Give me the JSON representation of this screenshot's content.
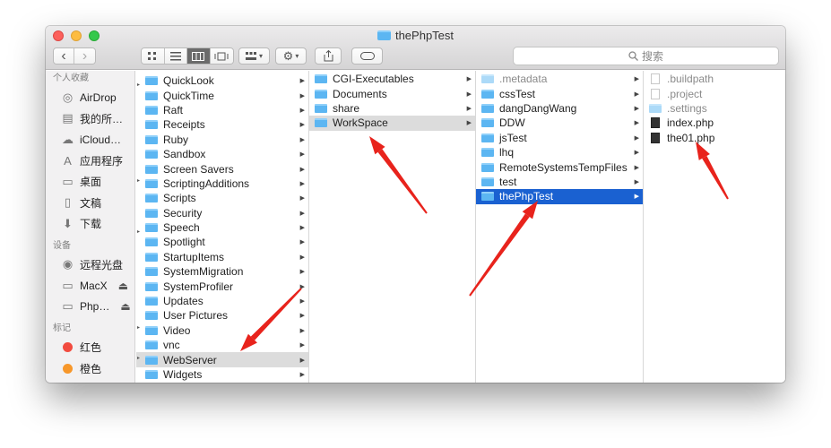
{
  "window": {
    "title": "thePhpTest"
  },
  "toolbar": {
    "nav_back": "‹",
    "nav_forward": "›",
    "search_placeholder": "搜索"
  },
  "sidebar": {
    "sections": [
      {
        "label": "个人收藏",
        "items": [
          {
            "label": "AirDrop",
            "icon": "airdrop-icon"
          },
          {
            "label": "我的所…",
            "icon": "documents-icon"
          },
          {
            "label": "iCloud…",
            "icon": "cloud-icon"
          },
          {
            "label": "应用程序",
            "icon": "applications-icon"
          },
          {
            "label": "桌面",
            "icon": "desktop-icon"
          },
          {
            "label": "文稿",
            "icon": "document-icon"
          },
          {
            "label": "下载",
            "icon": "download-icon"
          }
        ]
      },
      {
        "label": "设备",
        "items": [
          {
            "label": "远程光盘",
            "icon": "disc-icon"
          },
          {
            "label": "MacX",
            "icon": "drive-icon",
            "eject": "⏏"
          },
          {
            "label": "Php…",
            "icon": "drive-icon",
            "eject": "⏏"
          }
        ]
      },
      {
        "label": "标记",
        "items": [
          {
            "label": "红色",
            "color": "#f24b3f"
          },
          {
            "label": "橙色",
            "color": "#f7972a"
          }
        ]
      }
    ]
  },
  "columns": [
    {
      "items": [
        {
          "label": "QuickLook",
          "arrow": true
        },
        {
          "label": "QuickTime",
          "arrow": true
        },
        {
          "label": "Raft",
          "arrow": true
        },
        {
          "label": "Receipts",
          "arrow": true
        },
        {
          "label": "Ruby",
          "arrow": true
        },
        {
          "label": "Sandbox",
          "arrow": true
        },
        {
          "label": "Screen Savers",
          "arrow": true
        },
        {
          "label": "ScriptingAdditions",
          "arrow": true
        },
        {
          "label": "Scripts",
          "arrow": true
        },
        {
          "label": "Security",
          "arrow": true
        },
        {
          "label": "Speech",
          "arrow": true
        },
        {
          "label": "Spotlight",
          "arrow": true
        },
        {
          "label": "StartupItems",
          "arrow": true
        },
        {
          "label": "SystemMigration",
          "arrow": true
        },
        {
          "label": "SystemProfiler",
          "arrow": true
        },
        {
          "label": "Updates",
          "arrow": true
        },
        {
          "label": "User Pictures",
          "arrow": true
        },
        {
          "label": "Video",
          "arrow": true
        },
        {
          "label": "vnc",
          "arrow": true
        },
        {
          "label": "WebServer",
          "arrow": true,
          "selected": "gray"
        },
        {
          "label": "Widgets",
          "arrow": true
        }
      ]
    },
    {
      "items": [
        {
          "label": "CGI-Executables",
          "arrow": true
        },
        {
          "label": "Documents",
          "arrow": true
        },
        {
          "label": "share",
          "arrow": true
        },
        {
          "label": "WorkSpace",
          "arrow": true,
          "selected": "gray"
        }
      ]
    },
    {
      "items": [
        {
          "label": ".metadata",
          "arrow": true,
          "faded": true
        },
        {
          "label": "cssTest",
          "arrow": true
        },
        {
          "label": "dangDangWang",
          "arrow": true
        },
        {
          "label": "DDW",
          "arrow": true
        },
        {
          "label": "jsTest",
          "arrow": true
        },
        {
          "label": "lhq",
          "arrow": true
        },
        {
          "label": "RemoteSystemsTempFiles",
          "arrow": true
        },
        {
          "label": "test",
          "arrow": true
        },
        {
          "label": "thePhpTest",
          "arrow": true,
          "selected": "blue"
        }
      ]
    },
    {
      "items": [
        {
          "label": ".buildpath",
          "kind": "file",
          "faded": true
        },
        {
          "label": ".project",
          "kind": "file",
          "faded": true
        },
        {
          "label": ".settings",
          "kind": "folder",
          "faded": true
        },
        {
          "label": "index.php",
          "kind": "php"
        },
        {
          "label": "the01.php",
          "kind": "php"
        }
      ]
    }
  ],
  "annotation_color": "#e8231c"
}
